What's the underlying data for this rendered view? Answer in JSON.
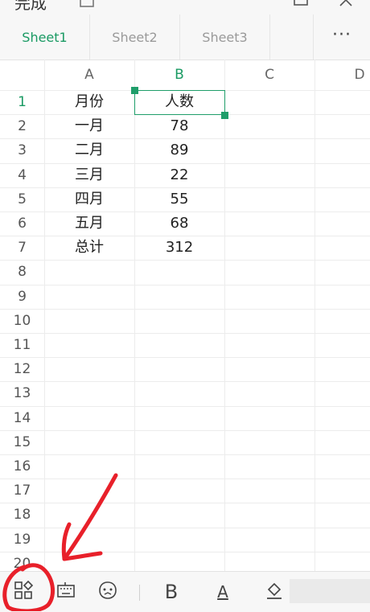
{
  "topbar": {
    "done_label": "完成"
  },
  "sheet_tabs": {
    "items": [
      {
        "label": "Sheet1",
        "active": true
      },
      {
        "label": "Sheet2",
        "active": false
      },
      {
        "label": "Sheet3",
        "active": false
      }
    ],
    "more_label": "···"
  },
  "grid": {
    "columns": [
      "A",
      "B",
      "C",
      "D"
    ],
    "rows": [
      "1",
      "2",
      "3",
      "4",
      "5",
      "6",
      "7",
      "8",
      "9",
      "10",
      "11",
      "12",
      "13",
      "14",
      "15",
      "16",
      "17",
      "18",
      "19",
      "20"
    ],
    "cells": {
      "A": [
        "月份",
        "一月",
        "二月",
        "三月",
        "四月",
        "五月",
        "总计"
      ],
      "B": [
        "人数",
        "78",
        "89",
        "22",
        "55",
        "68",
        "312"
      ]
    },
    "selected_cell": "B1"
  },
  "toolbar": {
    "bold_label": "B",
    "font_color_label": "A"
  },
  "colors": {
    "accent": "#1a9a63",
    "annotation": "#e8202a"
  }
}
